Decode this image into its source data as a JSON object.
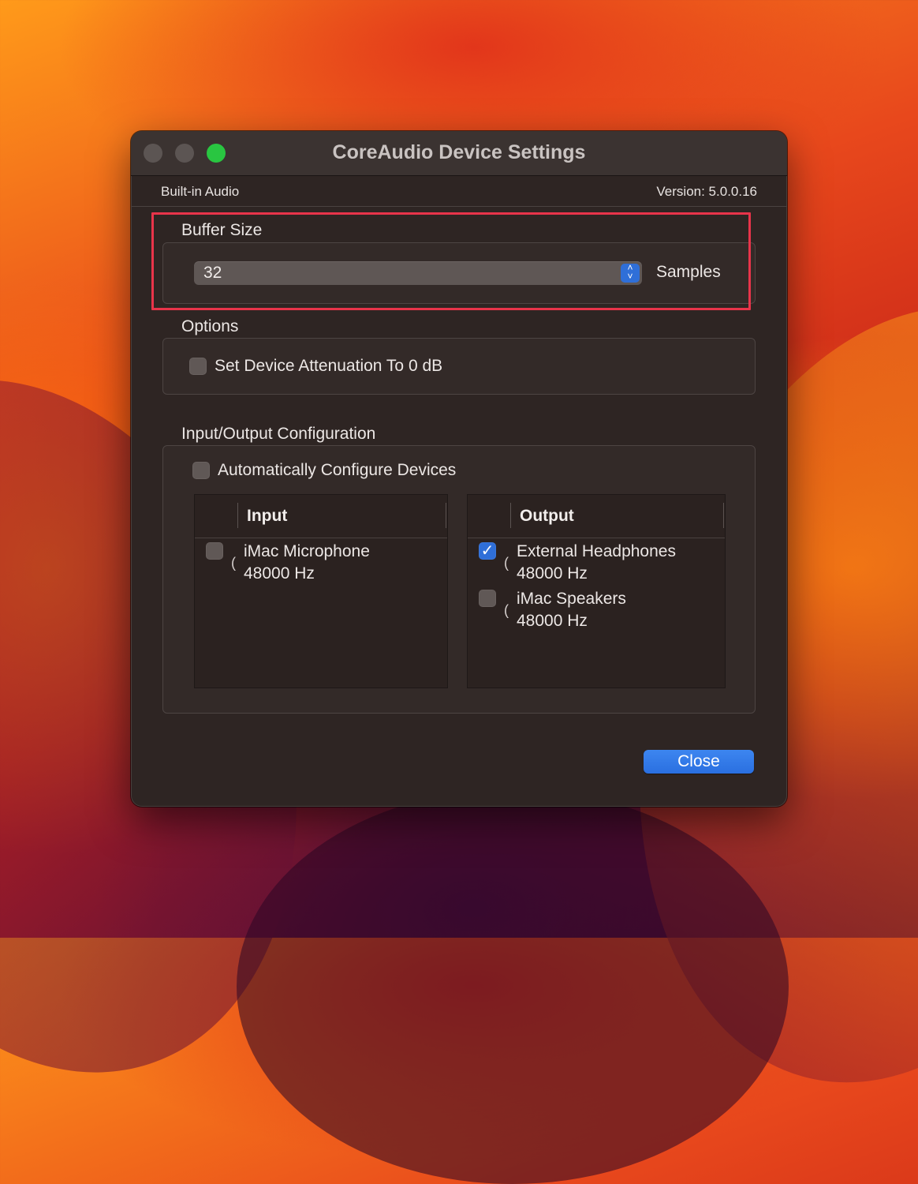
{
  "window": {
    "title": "CoreAudio Device Settings",
    "device_name": "Built-in Audio",
    "version": "Version: 5.0.0.16"
  },
  "buffer": {
    "label": "Buffer Size",
    "value": "32",
    "unit": "Samples"
  },
  "options": {
    "label": "Options",
    "attenuation_label": "Set Device Attenuation To 0 dB",
    "attenuation_checked": false
  },
  "io": {
    "label": "Input/Output Configuration",
    "auto_label": "Automatically Configure Devices",
    "auto_checked": false,
    "input": {
      "header": "Input",
      "items": [
        {
          "name": "iMac Microphone",
          "rate": "48000 Hz",
          "checked": false
        }
      ]
    },
    "output": {
      "header": "Output",
      "items": [
        {
          "name": "External Headphones",
          "rate": "48000 Hz",
          "checked": true
        },
        {
          "name": "iMac Speakers",
          "rate": "48000 Hz",
          "checked": false
        }
      ]
    }
  },
  "close_label": "Close",
  "colors": {
    "accent": "#2f6fd8",
    "highlight": "#e8344a",
    "zoom_light": "#29c641"
  }
}
